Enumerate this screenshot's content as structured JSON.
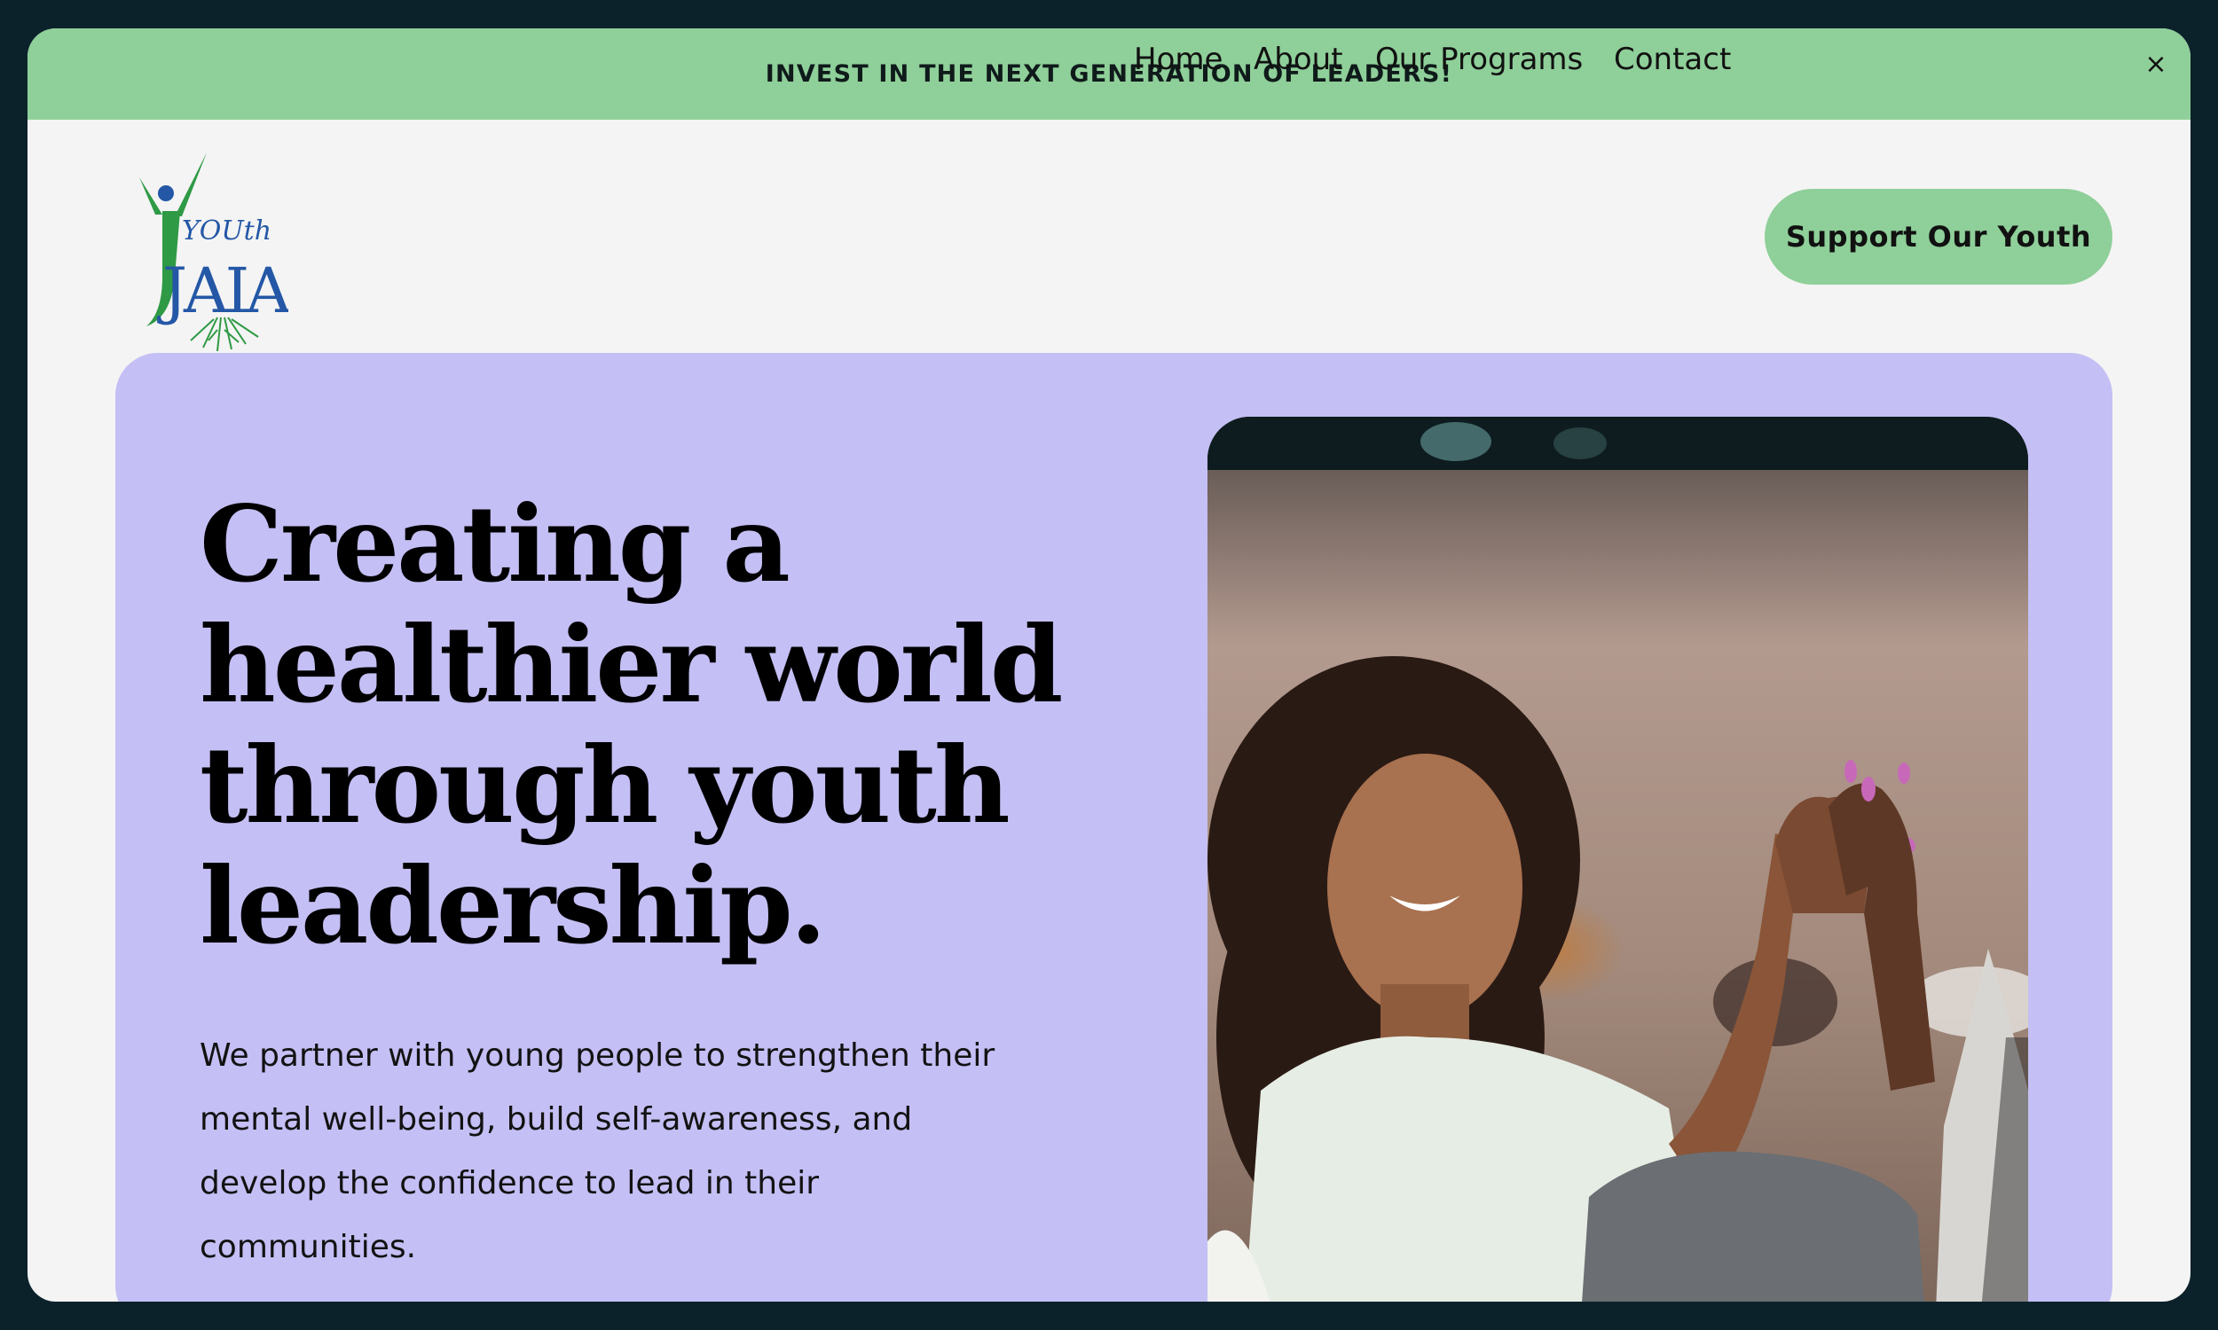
{
  "banner": {
    "text": "INVEST IN THE NEXT GENERATION OF LEADERS!",
    "close_icon": "×"
  },
  "logo": {
    "text_top": "YOUth",
    "text_main": "JAIA"
  },
  "nav": {
    "items": [
      "Home",
      "About",
      "Our Programs",
      "Contact"
    ],
    "cta": "Support Our Youth"
  },
  "hero": {
    "headline_lines": [
      "Creating a",
      "healthier world",
      "through youth",
      "leadership."
    ],
    "subtext": "We partner with young people to strengthen their mental well-being, build self-awareness, and develop the confidence to lead in their communities."
  },
  "colors": {
    "page_bg": "#0c222b",
    "accent_green": "#8fcf99",
    "hero_lavender": "#c4bff4",
    "logo_green": "#2f9a45",
    "logo_blue": "#2457a6"
  },
  "icons": {
    "close": "close-icon",
    "logo_figure": "person-figure-icon"
  }
}
